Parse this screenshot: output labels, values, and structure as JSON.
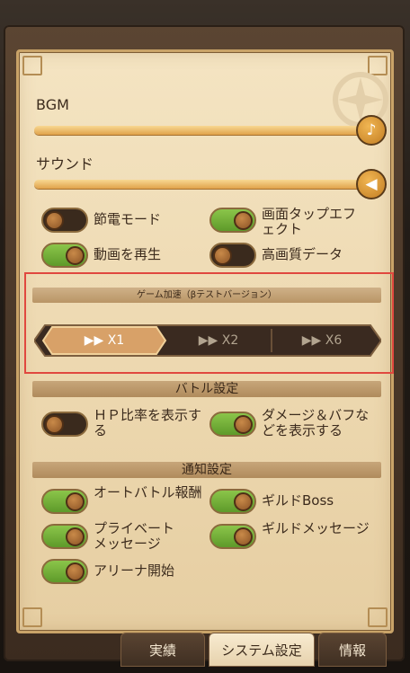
{
  "audio": {
    "bgm_label": "BGM",
    "sound_label": "サウンド",
    "bgm_level": 1.0,
    "sound_level": 1.0
  },
  "display_toggles": [
    {
      "label": "節電モード",
      "on": false
    },
    {
      "label": "画面タップエフェクト",
      "on": true
    },
    {
      "label": "動画を再生",
      "on": true
    },
    {
      "label": "高画質データ",
      "on": false
    }
  ],
  "speed": {
    "title": "ゲーム加速（βテストバージョン）",
    "options": [
      "X1",
      "X2",
      "X6"
    ],
    "selected": "X1"
  },
  "battle": {
    "title": "バトル設定",
    "toggles": [
      {
        "label": "ＨＰ比率を表示する",
        "on": false
      },
      {
        "label": "ダメージ＆バフなどを表示する",
        "on": true
      }
    ]
  },
  "notify": {
    "title": "通知設定",
    "toggles": [
      {
        "label": "オートバトル報酬",
        "on": true
      },
      {
        "label": "ギルドBoss",
        "on": true
      },
      {
        "label": "プライベートメッセージ",
        "on": true
      },
      {
        "label": "ギルドメッセージ",
        "on": true
      },
      {
        "label": "アリーナ開始",
        "on": true
      }
    ]
  },
  "tabs": [
    {
      "label": "実績"
    },
    {
      "label": "システム設定",
      "active": true
    },
    {
      "label": "情報"
    }
  ],
  "colors": {
    "toggle_on": "#6fad35",
    "toggle_off": "#3a2a1d",
    "highlight": "#e0483f"
  }
}
